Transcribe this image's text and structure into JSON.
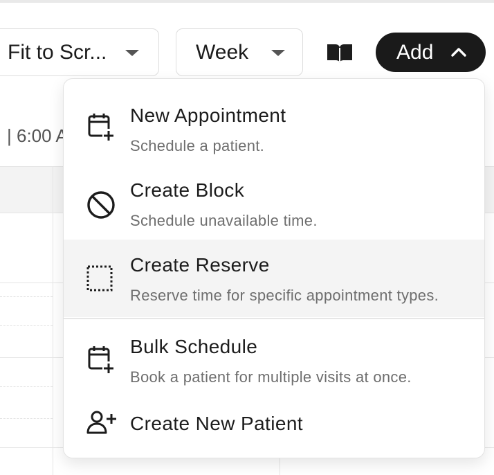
{
  "toolbar": {
    "zoom_select_value": "Fit to Scr...",
    "view_select_value": "Week",
    "guide_icon": "book-icon",
    "add_button_label": "Add",
    "add_button_icon": "chevron-up-icon"
  },
  "calendar": {
    "time_label": "| 6:00 A"
  },
  "add_menu": {
    "items": [
      {
        "icon": "calendar-plus-icon",
        "title": "New Appointment",
        "description": "Schedule a patient."
      },
      {
        "icon": "prohibited-icon",
        "title": "Create Block",
        "description": "Schedule unavailable time."
      },
      {
        "icon": "dotted-square-icon",
        "title": "Create Reserve",
        "description": "Reserve time for specific appointment types."
      },
      {
        "icon": "calendar-plus-icon",
        "title": "Bulk Schedule",
        "description": "Book a patient for multiple visits at once."
      },
      {
        "icon": "user-plus-icon",
        "title": "Create New Patient",
        "description": ""
      }
    ]
  },
  "colors": {
    "add_button_bg": "#1a1a1a",
    "hover_bg": "#f4f4f4",
    "muted_text": "#6e6e6e"
  }
}
